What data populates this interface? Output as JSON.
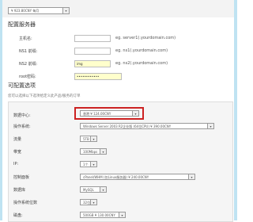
{
  "top_select": {
    "value": "¥ 923.80CNY 每月"
  },
  "server_config": {
    "heading": "配置服务器",
    "hostname": {
      "label": "主机名:",
      "hint": "eg. server1(.yourdomain.com)"
    },
    "ns1": {
      "label": "NS1 前缀:",
      "hint": "eg. ns1(.yourdomain.com)"
    },
    "ns2": {
      "label": "NS2 前缀:",
      "hint": "eg. ns2(.yourdomain.com)",
      "value": "img"
    },
    "root_password": {
      "label": "root密码:",
      "value": "••••••••••••"
    }
  },
  "configurable_options": {
    "heading": "可配置选项",
    "description": "您可以选择以下选项给定义此产品/服务的订单",
    "rows": [
      {
        "label": "数据中心:",
        "value": "香港 ¥ 124.00CNY"
      },
      {
        "label": "操作系统:",
        "value": "Windows Server 2003 R2企业版 (64位CPU) ¥ 390.00CNY"
      },
      {
        "label": "流量",
        "value": "5TB"
      },
      {
        "label": "带宽",
        "value": "100Mbps"
      },
      {
        "label": "IP:",
        "value": "1个"
      },
      {
        "label": "控制面板",
        "value": "cPanel/WHM (仅Linux服务器) ¥ 240.00CNY"
      },
      {
        "label": "数据库",
        "value": "MySQL"
      },
      {
        "label": "操作系统位数",
        "value": "32位"
      },
      {
        "label": "磁盘:",
        "value": "500GB ¥ 130.00CNY"
      }
    ]
  },
  "colors": {
    "highlight": "#cc2222",
    "panel_bg": "#f5f5f5",
    "input_yellow": "#ffffcc"
  }
}
